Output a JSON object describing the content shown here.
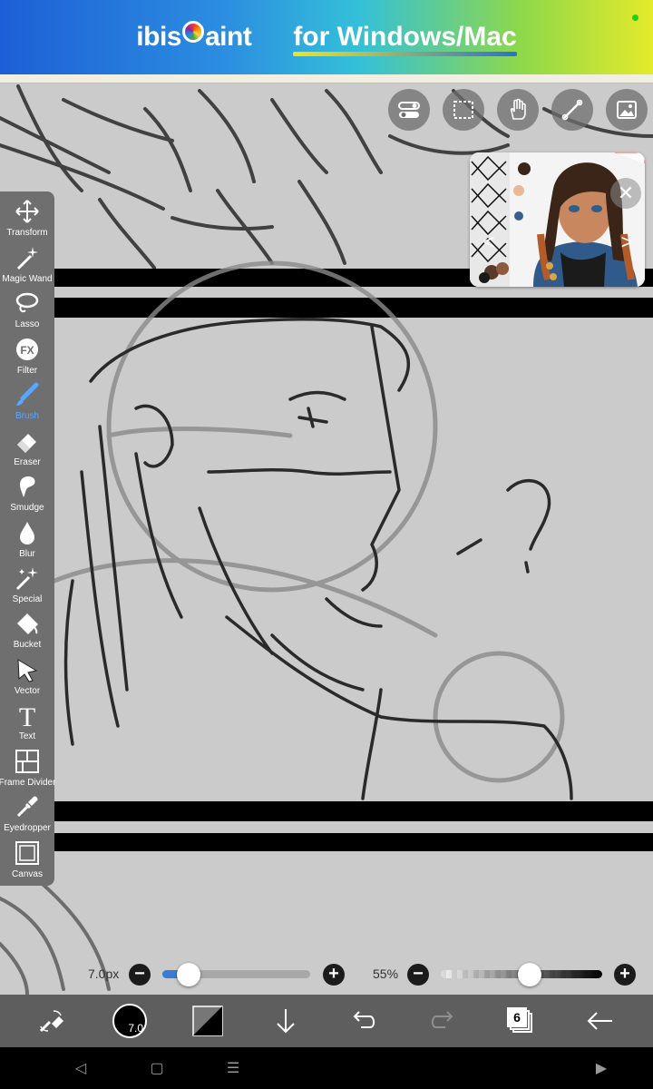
{
  "ad": {
    "brand_left": "ibis",
    "brand_right": "aint",
    "tagline": "for Windows/Mac",
    "status_dot_color": "#1bd11b"
  },
  "top_tools": [
    {
      "name": "layer-toggle-icon"
    },
    {
      "name": "selection-icon"
    },
    {
      "name": "hand-icon"
    },
    {
      "name": "ruler-icon"
    },
    {
      "name": "image-icon"
    }
  ],
  "reference_window": {
    "close_icon": "close-icon",
    "nav_left_icon": "chevron-left-icon",
    "nav_right_icon": "chevron-right-icon"
  },
  "toolbar": {
    "active_tool": "Brush",
    "active_color": "#5aa6ff",
    "tools": [
      {
        "label": "Transform",
        "icon": "move-icon"
      },
      {
        "label": "Magic Wand",
        "icon": "magic-wand-icon"
      },
      {
        "label": "Lasso",
        "icon": "lasso-icon"
      },
      {
        "label": "Filter",
        "icon": "fx-icon"
      },
      {
        "label": "Brush",
        "icon": "brush-icon"
      },
      {
        "label": "Eraser",
        "icon": "eraser-icon"
      },
      {
        "label": "Smudge",
        "icon": "smudge-icon"
      },
      {
        "label": "Blur",
        "icon": "drop-icon"
      },
      {
        "label": "Special",
        "icon": "sparkle-icon"
      },
      {
        "label": "Bucket",
        "icon": "bucket-icon"
      },
      {
        "label": "Vector",
        "icon": "cursor-icon"
      },
      {
        "label": "Text",
        "icon": "text-icon"
      },
      {
        "label": "Frame Divider",
        "icon": "frame-divider-icon"
      },
      {
        "label": "Eyedropper",
        "icon": "eyedropper-icon"
      },
      {
        "label": "Canvas",
        "icon": "canvas-icon"
      }
    ]
  },
  "sliders": {
    "brush_size": {
      "value_text": "7.0px",
      "fraction": 0.18,
      "minus": "−",
      "plus": "+"
    },
    "opacity": {
      "value_text": "55%",
      "fraction": 0.55,
      "minus": "−",
      "plus": "+"
    }
  },
  "bottombar": {
    "brush_size_text": "7.0",
    "layer_count": "6",
    "color_primary": "#000000"
  },
  "navbar": {
    "back": "◁",
    "home": "▢",
    "menu": "☰",
    "forward": "▶"
  }
}
